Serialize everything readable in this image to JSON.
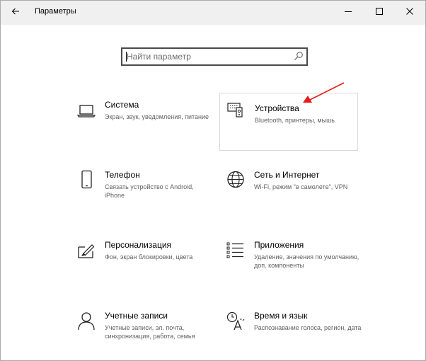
{
  "window": {
    "title": "Параметры"
  },
  "search": {
    "placeholder": "Найти параметр"
  },
  "categories": [
    {
      "name": "Система",
      "desc": "Экран, звук, уведомления, питание",
      "icon": "laptop-icon"
    },
    {
      "name": "Устройства",
      "desc": "Bluetooth, принтеры, мышь",
      "icon": "devices-icon"
    },
    {
      "name": "Телефон",
      "desc": "Связать устройство с Android, iPhone",
      "icon": "phone-icon"
    },
    {
      "name": "Сеть и Интернет",
      "desc": "Wi-Fi, режим \"в самолете\", VPN",
      "icon": "globe-icon"
    },
    {
      "name": "Персонализация",
      "desc": "Фон, экран блокировки, цвета",
      "icon": "paintbrush-icon"
    },
    {
      "name": "Приложения",
      "desc": "Удаление, значения по умолчанию, доп. компоненты",
      "icon": "apps-list-icon"
    },
    {
      "name": "Учетные записи",
      "desc": "Учетные записи, эл. почта, синхронизация, работа, семья",
      "icon": "person-icon"
    },
    {
      "name": "Время и язык",
      "desc": "Распознавание голоса, регион, дата",
      "icon": "time-language-icon"
    }
  ],
  "annotation": {
    "arrow_color": "#e81a1a",
    "points_to": "Устройства"
  }
}
